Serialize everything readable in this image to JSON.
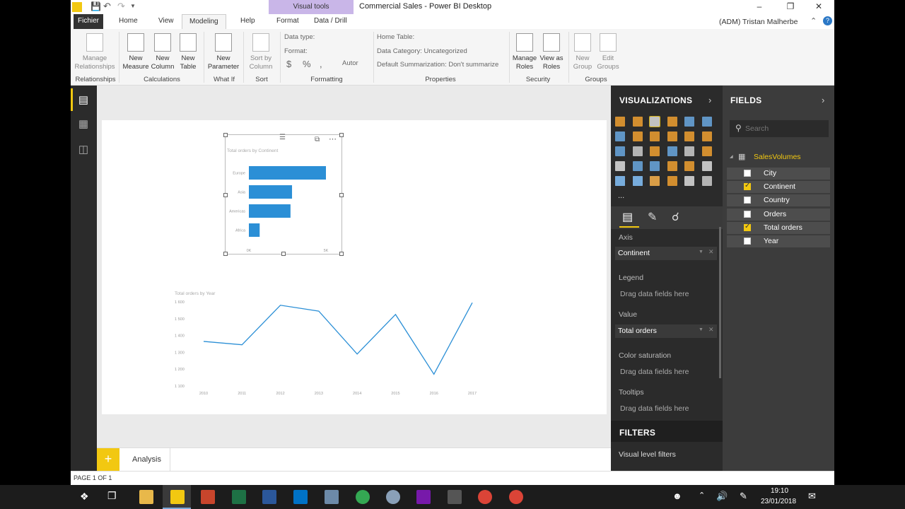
{
  "window": {
    "title": "Commercial Sales - Power BI Desktop",
    "context_tab_group": "Visual tools",
    "user": "(ADM) Tristan Malherbe"
  },
  "ribbon_tabs": [
    {
      "label": "Fichier"
    },
    {
      "label": "Home"
    },
    {
      "label": "View"
    },
    {
      "label": "Modeling"
    },
    {
      "label": "Help"
    },
    {
      "label": "Format"
    },
    {
      "label": "Data / Drill"
    }
  ],
  "ribbon": {
    "manage_relationships": "Manage Relationships",
    "new_measure": "New Measure",
    "new_column": "New Column",
    "new_table": "New Table",
    "new_parameter": "New Parameter",
    "sort_by_column": "Sort by Column",
    "data_type": "Data type:",
    "format": "Format:",
    "currency": "$",
    "percent": "%",
    "comma": ",",
    "auto": "Autor",
    "home_table": "Home Table:",
    "data_category": "Data Category: Uncategorized",
    "default_summarization": "Default Summarization: Don't summarize",
    "manage_roles": "Manage Roles",
    "view_as_roles": "View as Roles",
    "new_group": "New Group",
    "edit_groups": "Edit Groups",
    "groups": {
      "relationships": "Relationships",
      "calculations": "Calculations",
      "what_if": "What If",
      "sort": "Sort",
      "formatting": "Formatting",
      "properties": "Properties",
      "security": "Security",
      "groups": "Groups"
    }
  },
  "bar_chart": {
    "title": "Total orders by Continent",
    "x_ticks": [
      "0K",
      "5K"
    ],
    "chart_data": {
      "type": "bar",
      "title": "Total orders by Continent",
      "categories": [
        "Europe",
        "Asia",
        "Americas",
        "Africa"
      ],
      "values": [
        5000,
        2800,
        2700,
        700
      ],
      "xlim": [
        0,
        5000
      ],
      "color": "#2b8fd6"
    }
  },
  "line_chart": {
    "title": "Total orders by Year",
    "chart_data": {
      "type": "line",
      "title": "Total orders by Year",
      "x": [
        "2010",
        "2011",
        "2012",
        "2013",
        "2014",
        "2015",
        "2016",
        "2017"
      ],
      "values": [
        1365,
        1345,
        1580,
        1545,
        1290,
        1525,
        1170,
        1595
      ],
      "y_ticks": [
        "1 600",
        "1 500",
        "1 400",
        "1 300",
        "1 200",
        "1 100"
      ],
      "ylim": [
        1100,
        1600
      ],
      "color": "#2b8fd6"
    }
  },
  "pages": {
    "add_label": "+",
    "tabs": [
      {
        "label": "Analysis"
      }
    ]
  },
  "status": {
    "page": "PAGE 1 OF 1"
  },
  "visualizations": {
    "title": "VISUALIZATIONS",
    "more": "...",
    "wells": {
      "axis_label": "Axis",
      "axis_field": "Continent",
      "legend_label": "Legend",
      "legend_drop": "Drag data fields here",
      "value_label": "Value",
      "value_field": "Total orders",
      "color_sat_label": "Color saturation",
      "color_sat_drop": "Drag data fields here",
      "tooltips_label": "Tooltips",
      "tooltips_drop": "Drag data fields here"
    },
    "filters_title": "FILTERS",
    "visual_level_filters": "Visual level filters"
  },
  "fields": {
    "title": "FIELDS",
    "search_placeholder": "Search",
    "table_name": "SalesVolumes",
    "items": [
      {
        "label": "City",
        "checked": false
      },
      {
        "label": "Continent",
        "checked": true
      },
      {
        "label": "Country",
        "checked": false
      },
      {
        "label": "Orders",
        "checked": false
      },
      {
        "label": "Total orders",
        "checked": true
      },
      {
        "label": "Year",
        "checked": false
      }
    ]
  },
  "taskbar": {
    "time": "19:10",
    "date": "23/01/2018"
  }
}
